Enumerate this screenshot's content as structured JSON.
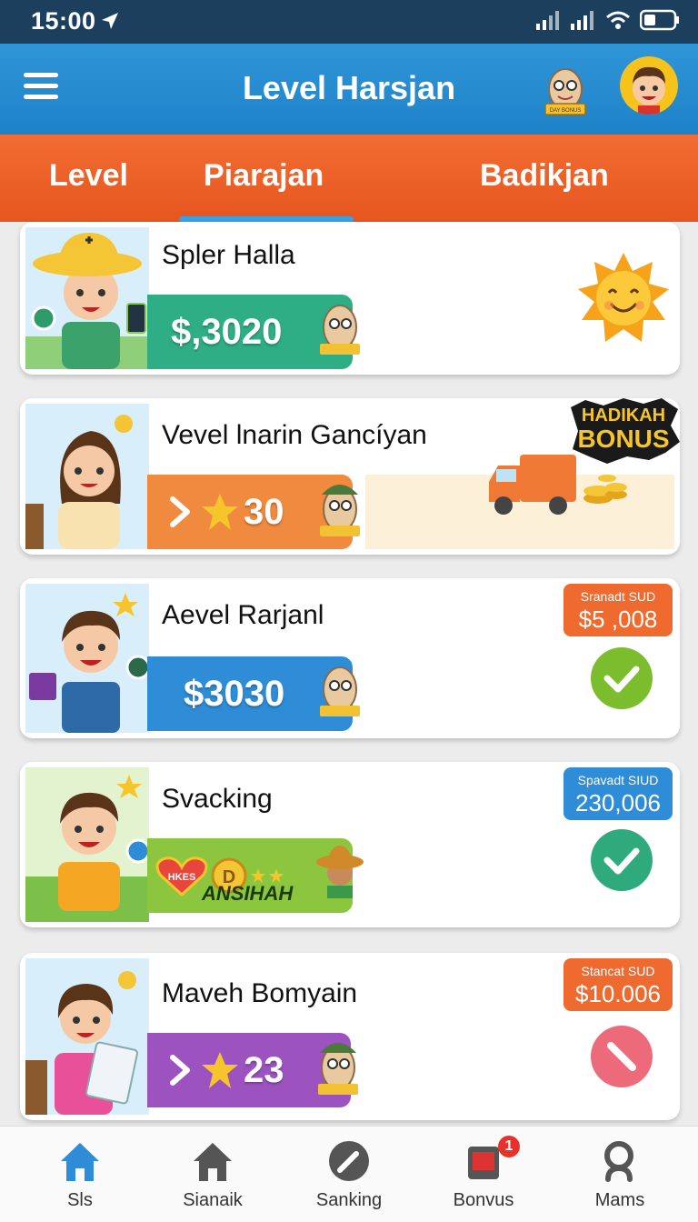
{
  "status_bar": {
    "time": "15:00"
  },
  "header": {
    "title": "Level Harsjan",
    "mascot_badge": "DAY BONUS"
  },
  "tabs": [
    {
      "label": "Level"
    },
    {
      "label": "Piarajan"
    },
    {
      "label": "Badikjan"
    }
  ],
  "cards": [
    {
      "title": "Spler Halla",
      "amount": "$,3020",
      "pill_color": "#2fae86",
      "badge_icon": "smiling-sun-icon"
    },
    {
      "title": "Vevel lnarin Gancíyan",
      "amount": "30",
      "pill_color": "#f08a3e",
      "bonus_line1": "HADIKAH",
      "bonus_line2": "BONUS",
      "bonus_icon": "delivery-truck-with-coins-icon"
    },
    {
      "title": "Aevel Rarjanl",
      "amount": "$3030",
      "pill_color": "#2f8dd7",
      "tag_label": "Sranadt SUD",
      "tag_value": "$5 ,008",
      "tag_color": "#ee6a2f",
      "status": "completed",
      "status_color": "#7bbd2c"
    },
    {
      "title": "Svacking",
      "reward_text": "ANSIHAH",
      "heart_text": "HKES",
      "pill_color": "#8cc63f",
      "tag_label": "Spavadt SIUD",
      "tag_value": "230,006",
      "tag_color": "#2f8dd7",
      "status": "completed",
      "status_color": "#2eaa7d"
    },
    {
      "title": "Maveh Bomyain",
      "amount": "23",
      "pill_color": "#9c53c0",
      "tag_label": "Stancat SUD",
      "tag_value": "$10.006",
      "tag_color": "#ee6a2f",
      "status": "blocked",
      "status_color": "#ec6a7a"
    }
  ],
  "bottom_nav": [
    {
      "label": "Sls",
      "icon": "home-icon",
      "active": true
    },
    {
      "label": "Sianaik",
      "icon": "house-icon"
    },
    {
      "label": "Sanking",
      "icon": "pencil-circle-icon"
    },
    {
      "label": "Bonvus",
      "icon": "tablet-icon",
      "badge": "1"
    },
    {
      "label": "Mams",
      "icon": "search-icon"
    }
  ]
}
